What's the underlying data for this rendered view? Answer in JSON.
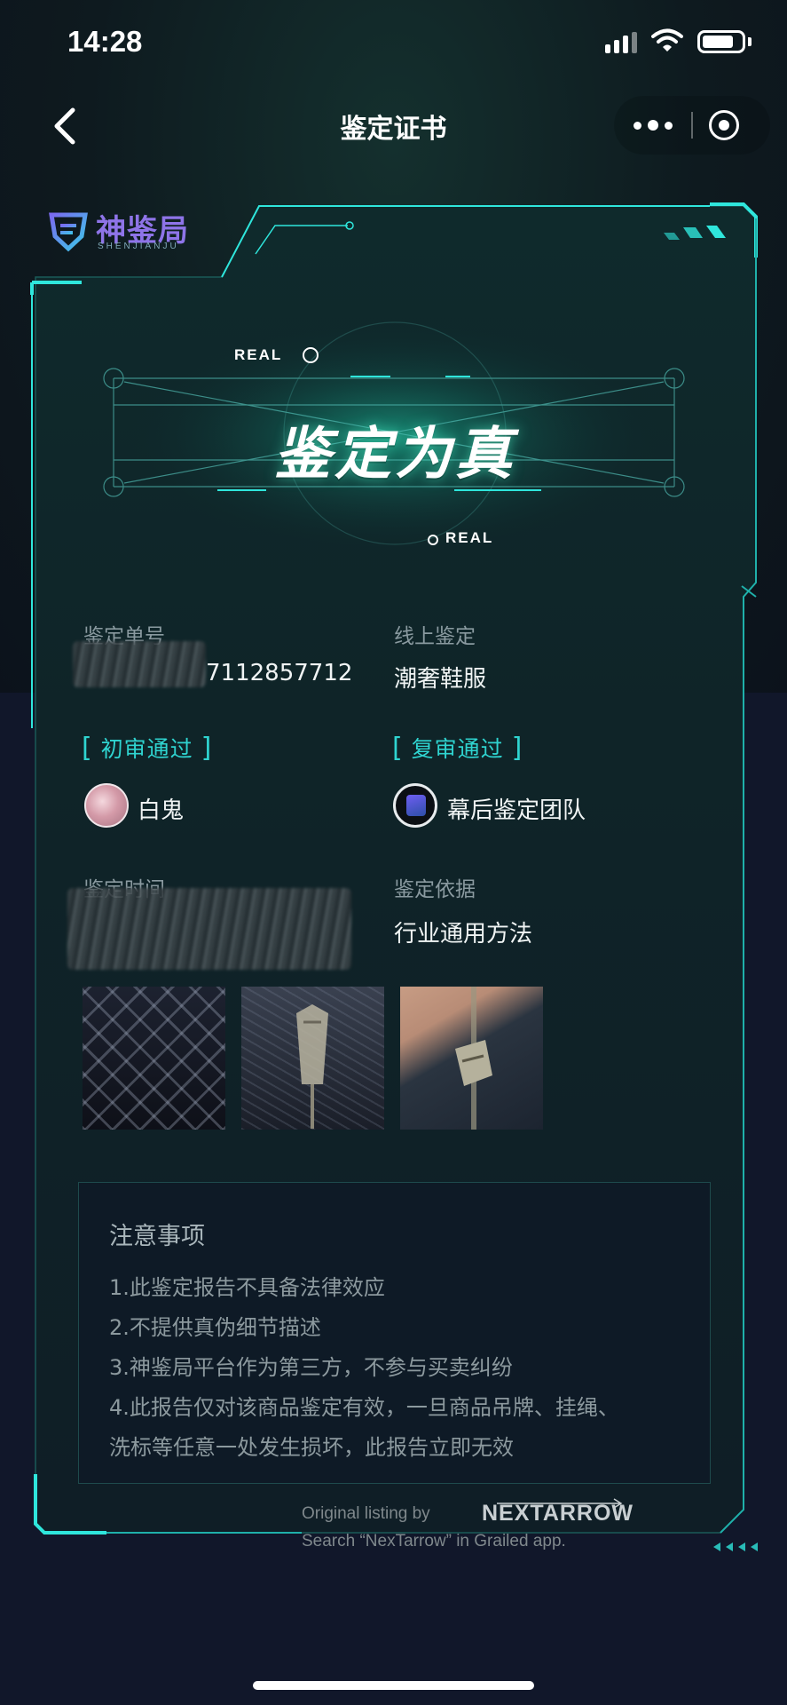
{
  "status_bar": {
    "time": "14:28"
  },
  "nav": {
    "title": "鉴定证书"
  },
  "logo": {
    "name": "神鉴局",
    "sub": "SHENJIANJU"
  },
  "banner": {
    "tag_top": "REAL",
    "tag_bottom": "REAL",
    "result": "鉴定为真"
  },
  "info": {
    "order_label": "鉴定单号",
    "order_value": "7112857712",
    "type_label": "线上鉴定",
    "type_value": "潮奢鞋服",
    "first_review_tag": "初审通过",
    "first_reviewer": "白鬼",
    "second_review_tag": "复审通过",
    "second_reviewer": "幕后鉴定团队",
    "time_label": "鉴定时间",
    "basis_label": "鉴定依据",
    "basis_value": "行业通用方法"
  },
  "notice": {
    "title": "注意事项",
    "items": [
      "1.此鉴定报告不具备法律效应",
      "2.不提供真伪细节描述",
      "3.神鉴局平台作为第三方，不参与买卖纠纷",
      "4.此报告仅对该商品鉴定有效，一旦商品吊牌、挂绳、",
      "洗标等任意一处发生损坏，此报告立即无效"
    ]
  },
  "watermark": {
    "line1": "Original listing by",
    "brand": "NEXTARROW",
    "line2": "Search “NexTarrow” in Grailed app."
  },
  "colors": {
    "accent": "#2fd4d0",
    "frame": "#1fd0c8",
    "background": "#0f1522"
  }
}
